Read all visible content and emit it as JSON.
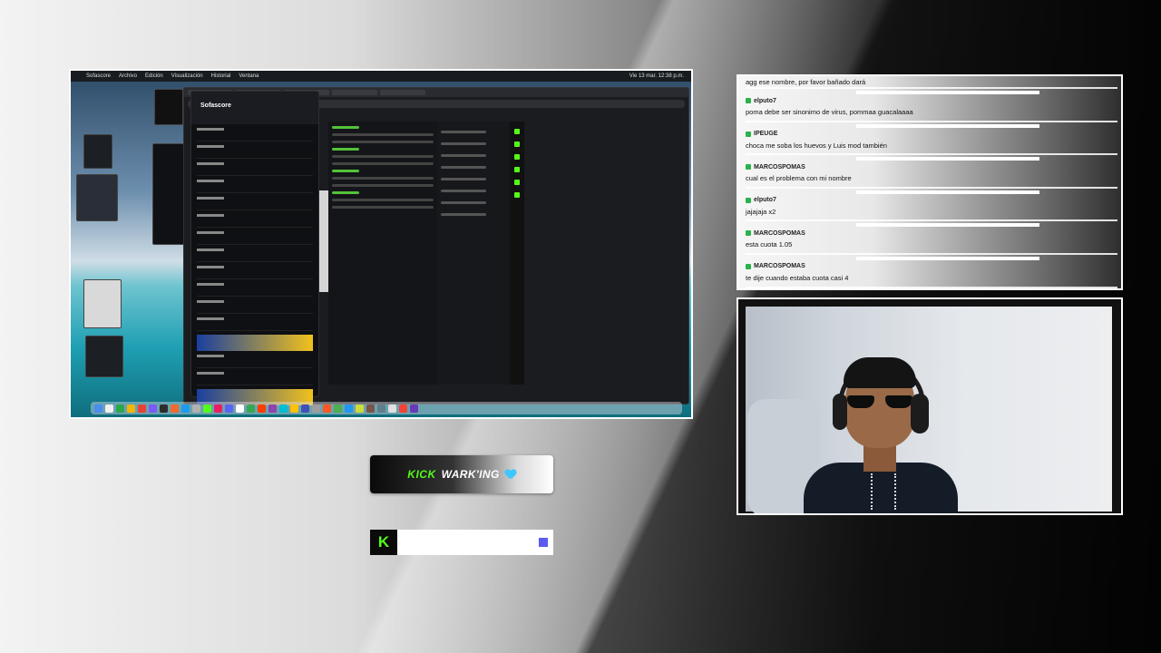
{
  "screen_capture": {
    "menubar": [
      "Sofascore",
      "Archivo",
      "Edición",
      "Visualización",
      "Historial",
      "Ventana"
    ],
    "menubar_right": "Vie 13 mar. 12:38 p.m.",
    "sofascore_title": "Sofascore",
    "dock_colors": [
      "#4a8cf0",
      "#f0f0f0",
      "#2aa84a",
      "#f2b705",
      "#e94235",
      "#7a5af8",
      "#2d2d2d",
      "#f06a2c",
      "#1e9bf0",
      "#b1b1b1",
      "#53fc18",
      "#e91e63",
      "#5865f2",
      "#ffffff",
      "#34a853",
      "#ff3d00",
      "#8e44ad",
      "#00bcd4",
      "#ffc107",
      "#3f51b5",
      "#9e9e9e",
      "#ff5722",
      "#4caf50",
      "#2196f3",
      "#cddc39",
      "#795548",
      "#607d8b",
      "#e0e0e0",
      "#f44336",
      "#673ab7"
    ]
  },
  "kick_overlay": {
    "brand": "KICK",
    "handle": "WARK'ING",
    "logo_letter": "K",
    "accent": "#53fc18",
    "heart_color": "#3ec6ff",
    "square_color": "#5b5bf0"
  },
  "chat": {
    "partial_top": "agg ese nombre, por favor bañado dará",
    "messages": [
      {
        "user": "elputo7",
        "text": "poma debe ser sinonimo de virus, pommaa guacalaaaa"
      },
      {
        "user": "IPEUGE",
        "text": "choca me soba los huevos y Luis mod también"
      },
      {
        "user": "MARCOSPOMAS",
        "text": "cual es el problema con mi nombre"
      },
      {
        "user": "elputo7",
        "text": "jajajaja x2"
      },
      {
        "user": "MARCOSPOMAS",
        "text": "esta cuota 1.05"
      },
      {
        "user": "MARCOSPOMAS",
        "text": "te dije cuando estaba cuota casi 4"
      }
    ],
    "badge_color": "#2bb24c"
  }
}
